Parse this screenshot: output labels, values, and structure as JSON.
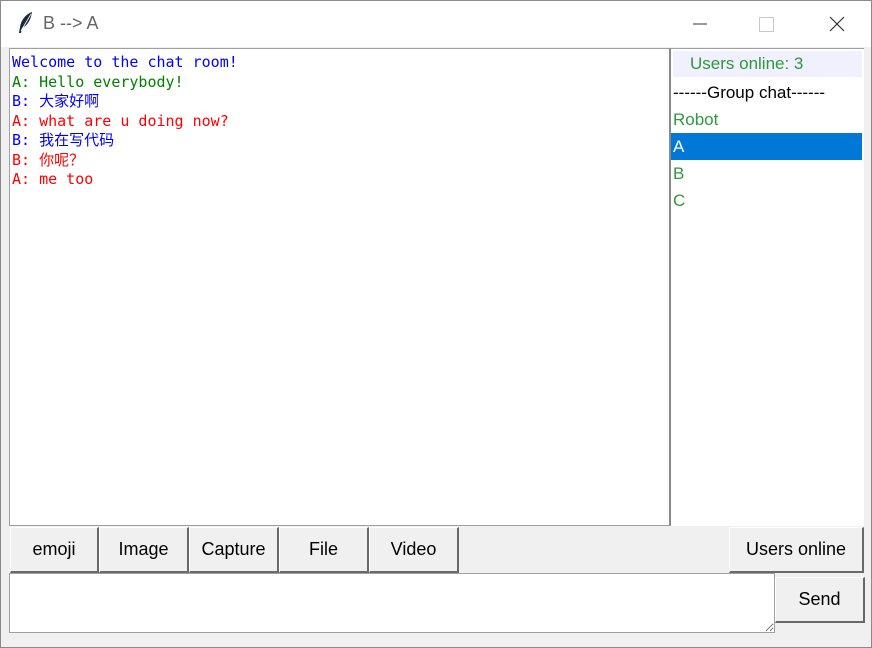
{
  "window": {
    "title": "B --> A"
  },
  "chat": {
    "messages": [
      {
        "text": "Welcome to the chat room!",
        "color": "#0000ff"
      },
      {
        "text": "A: Hello everybody!",
        "color": "#008000"
      },
      {
        "text": "B: 大家好啊",
        "color": "#0000ff"
      },
      {
        "text": "A: what are u doing now?",
        "color": "#ff0000"
      },
      {
        "text": "B: 我在写代码",
        "color": "#0000ff"
      },
      {
        "text": "B: 你呢？",
        "color": "#ff0000"
      },
      {
        "text": "A: me too",
        "color": "#ff0000"
      }
    ]
  },
  "users": {
    "count_label": "Users online: 3",
    "items": [
      {
        "label": "------Group chat------",
        "selected": false
      },
      {
        "label": "Robot",
        "selected": false
      },
      {
        "label": "A",
        "selected": true
      },
      {
        "label": "B",
        "selected": false
      },
      {
        "label": "C",
        "selected": false
      }
    ]
  },
  "toolbar": {
    "emoji_label": "emoji",
    "image_label": "Image",
    "capture_label": "Capture",
    "file_label": "File",
    "video_label": "Video",
    "users_online_label": "Users online"
  },
  "input": {
    "value": "",
    "placeholder": ""
  },
  "send": {
    "label": "Send"
  },
  "colors": {
    "selection": "#0078d7",
    "user_green": "#2e9a3a"
  }
}
